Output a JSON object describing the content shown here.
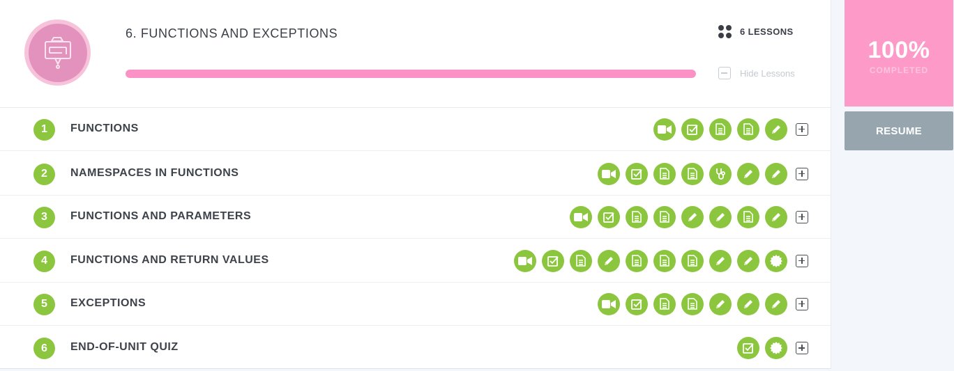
{
  "unit": {
    "title": "6. FUNCTIONS AND EXCEPTIONS",
    "badge_icon": "flowchart-icon",
    "progress_percent": 100,
    "lessons_label": "6 LESSONS",
    "hide_lessons_label": "Hide Lessons"
  },
  "completion": {
    "percent_label": "100%",
    "status_label": "COMPLETED"
  },
  "resume_label": "RESUME",
  "colors": {
    "accent_green": "#8cc63f",
    "accent_pink": "#fd9ac8",
    "resume_gray": "#97a5af"
  },
  "lessons": [
    {
      "number": "1",
      "title": "FUNCTIONS",
      "activities": [
        "video",
        "quiz",
        "document",
        "document",
        "pencil"
      ]
    },
    {
      "number": "2",
      "title": "NAMESPACES IN FUNCTIONS",
      "activities": [
        "video",
        "quiz",
        "document",
        "document",
        "stethoscope",
        "pencil",
        "pencil"
      ]
    },
    {
      "number": "3",
      "title": "FUNCTIONS AND PARAMETERS",
      "activities": [
        "video",
        "quiz",
        "document",
        "document",
        "pencil",
        "pencil",
        "document",
        "pencil"
      ]
    },
    {
      "number": "4",
      "title": "FUNCTIONS AND RETURN VALUES",
      "activities": [
        "video",
        "quiz",
        "document",
        "pencil",
        "document",
        "document",
        "document",
        "pencil",
        "pencil",
        "badge"
      ]
    },
    {
      "number": "5",
      "title": "EXCEPTIONS",
      "activities": [
        "video",
        "quiz",
        "document",
        "document",
        "pencil",
        "pencil",
        "pencil"
      ]
    },
    {
      "number": "6",
      "title": "END-OF-UNIT QUIZ",
      "activities": [
        "quiz",
        "badge"
      ]
    }
  ]
}
